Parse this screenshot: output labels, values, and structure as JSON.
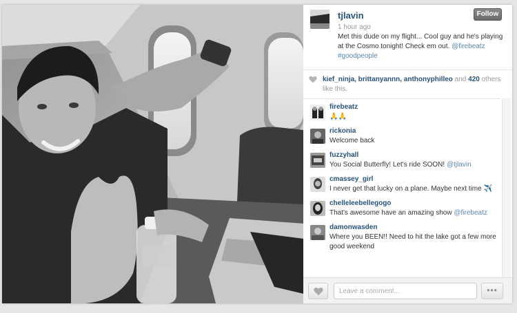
{
  "post": {
    "username": "tjlavin",
    "timestamp": "1 hour ago",
    "follow_label": "Follow",
    "caption_text": "Met this dude on my flight... Cool guy and he's playing at the Cosmo tonight! Check em out. ",
    "caption_mention": "@firebeatz",
    "caption_hashtag": "#goodpeople"
  },
  "likes": {
    "names": "kief_ninja, brittanyannn, anthonyphilleo",
    "connector": " and ",
    "count": "420",
    "suffix": " others like this."
  },
  "comments": [
    {
      "user": "firebeatz",
      "text": "🙏🙏",
      "mention": ""
    },
    {
      "user": "rickonia",
      "text": "Welcome back",
      "mention": ""
    },
    {
      "user": "fuzzyhall",
      "text": "You Social Butterfly! Let's ride SOON! ",
      "mention": "@tjlavin"
    },
    {
      "user": "cmassey_girl",
      "text": "I never get that lucky on a plane. Maybe next time ✈️",
      "mention": ""
    },
    {
      "user": "chelleleebellegogo",
      "text": "That's awesome have an amazing show ",
      "mention": "@firebeatz"
    },
    {
      "user": "damonwasden",
      "text": "Where you BEEN!! Need to hit the lake got a few more good weekend",
      "mention": ""
    }
  ],
  "footer": {
    "comment_placeholder": "Leave a comment...",
    "more_label": "•••"
  },
  "icons": {
    "heart": "heart-icon",
    "more": "more-options-icon"
  },
  "colors": {
    "username": "#27537c",
    "mention": "#5b87ad",
    "follow_button": "#7a7a7a"
  }
}
